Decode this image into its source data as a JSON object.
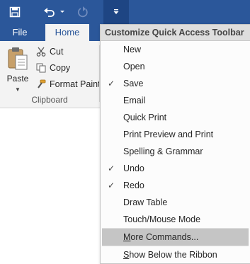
{
  "quick_access": {
    "save_icon": "save-icon",
    "undo_icon": "undo-icon",
    "redo_icon": "redo-icon",
    "customize_icon": "customize-qat-icon"
  },
  "tabs": [
    {
      "label": "File"
    },
    {
      "label": "Home"
    }
  ],
  "clipboard": {
    "paste_label": "Paste",
    "cut_label": "Cut",
    "copy_label": "Copy",
    "format_painter_label": "Format Painte",
    "group_label": "Clipboard"
  },
  "menu": {
    "header": "Customize Quick Access Toolbar",
    "items": [
      {
        "label": "New",
        "checked": false
      },
      {
        "label": "Open",
        "checked": false
      },
      {
        "label": "Save",
        "checked": true
      },
      {
        "label": "Email",
        "checked": false
      },
      {
        "label": "Quick Print",
        "checked": false
      },
      {
        "label": "Print Preview and Print",
        "checked": false
      },
      {
        "label": "Spelling & Grammar",
        "checked": false
      },
      {
        "label": "Undo",
        "checked": true
      },
      {
        "label": "Redo",
        "checked": true
      },
      {
        "label": "Draw Table",
        "checked": false
      },
      {
        "label": "Touch/Mouse Mode",
        "checked": false
      }
    ],
    "more_commands": {
      "accel": "M",
      "rest": "ore Commands..."
    },
    "show_below": {
      "accel": "S",
      "rest": "how Below the Ribbon"
    },
    "check_glyph": "✓"
  },
  "colors": {
    "accent": "#2b579a",
    "ribbon_bg": "#f3f3f3",
    "menu_highlight": "#c5c5c5"
  }
}
